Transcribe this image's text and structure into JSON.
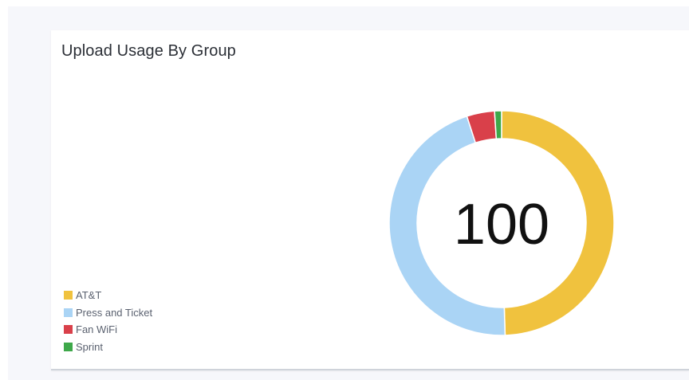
{
  "panel": {
    "title": "Upload Usage By Group",
    "center_value": "100"
  },
  "chart_data": {
    "type": "pie",
    "title": "Upload Usage By Group",
    "center_label": "100",
    "legend_position": "bottom-left",
    "categories": [
      "AT&T",
      "Press and Ticket",
      "Fan WiFi",
      "Sprint"
    ],
    "values": [
      49.5,
      45.5,
      4.0,
      1.0
    ],
    "colors": [
      "#f0c23e",
      "#aad4f5",
      "#d9404a",
      "#3ea84a"
    ]
  }
}
